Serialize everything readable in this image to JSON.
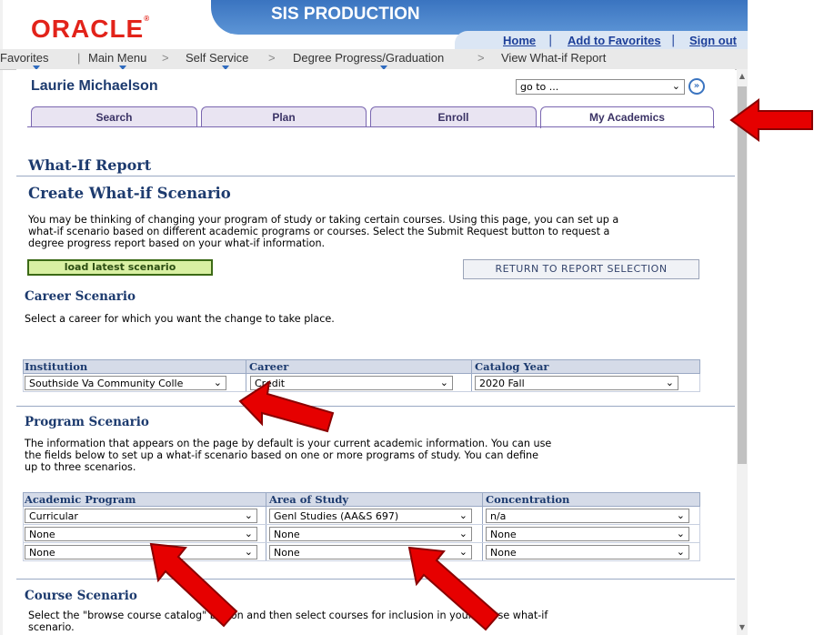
{
  "header": {
    "logo_text": "ORACLE",
    "logo_mark": "®",
    "banner_title": "SIS PRODUCTION",
    "links": {
      "home": "Home",
      "add_favorites": "Add to Favorites",
      "sign_out": "Sign out"
    },
    "brand_color": "#e2231a",
    "banner_color": "#3a74c0"
  },
  "nav": {
    "items": [
      "Favorites",
      "Main Menu",
      "Self Service",
      "Degree Progress/Graduation",
      "View What-if Report"
    ],
    "separator": ">"
  },
  "student": {
    "name": "Laurie Michaelson",
    "goto_value": "go to ..."
  },
  "tabs": [
    {
      "label": "Search",
      "active": false
    },
    {
      "label": "Plan",
      "active": false
    },
    {
      "label": "Enroll",
      "active": false
    },
    {
      "label": "My Academics",
      "active": true
    }
  ],
  "page": {
    "title": "What-If Report",
    "subtitle": "Create What-if Scenario",
    "intro_lines": [
      "You may be thinking of changing your program of study or taking certain courses. Using this page, you can set up a",
      "what-if scenario based on different academic programs or courses. Select the Submit Request button to request a",
      "degree progress report based on your what-if information."
    ],
    "load_button": "load latest scenario",
    "return_button": "RETURN TO REPORT SELECTION"
  },
  "career": {
    "heading": "Career Scenario",
    "description": "Select a career for which you want the change to take place.",
    "columns": [
      "Institution",
      "Career",
      "Catalog Year"
    ],
    "values": [
      "Southside Va Community Colle",
      "Credit",
      "2020 Fall"
    ]
  },
  "program": {
    "heading": "Program Scenario",
    "description_lines": [
      "The information that appears on the page by default is your current academic information. You can use",
      "the fields below to set up a what-if scenario based on one or more programs of study. You can define",
      "up to three scenarios."
    ],
    "columns": [
      "Academic Program",
      "Area of Study",
      "Concentration"
    ],
    "rows": [
      [
        "Curricular",
        "Genl Studies (AA&S 697)",
        "n/a"
      ],
      [
        "None",
        "None",
        "None"
      ],
      [
        "None",
        "None",
        "None"
      ]
    ]
  },
  "course": {
    "heading": "Course Scenario",
    "description_lines": [
      "Select the \"browse course catalog\" button and then select courses for inclusion in your course what-if",
      "scenario."
    ]
  },
  "icons": {
    "dropdown": "chevron-down-icon",
    "go": "double-chevron-right-icon",
    "annotation": "red-arrow-icon"
  },
  "annotation_color": "#e60000"
}
